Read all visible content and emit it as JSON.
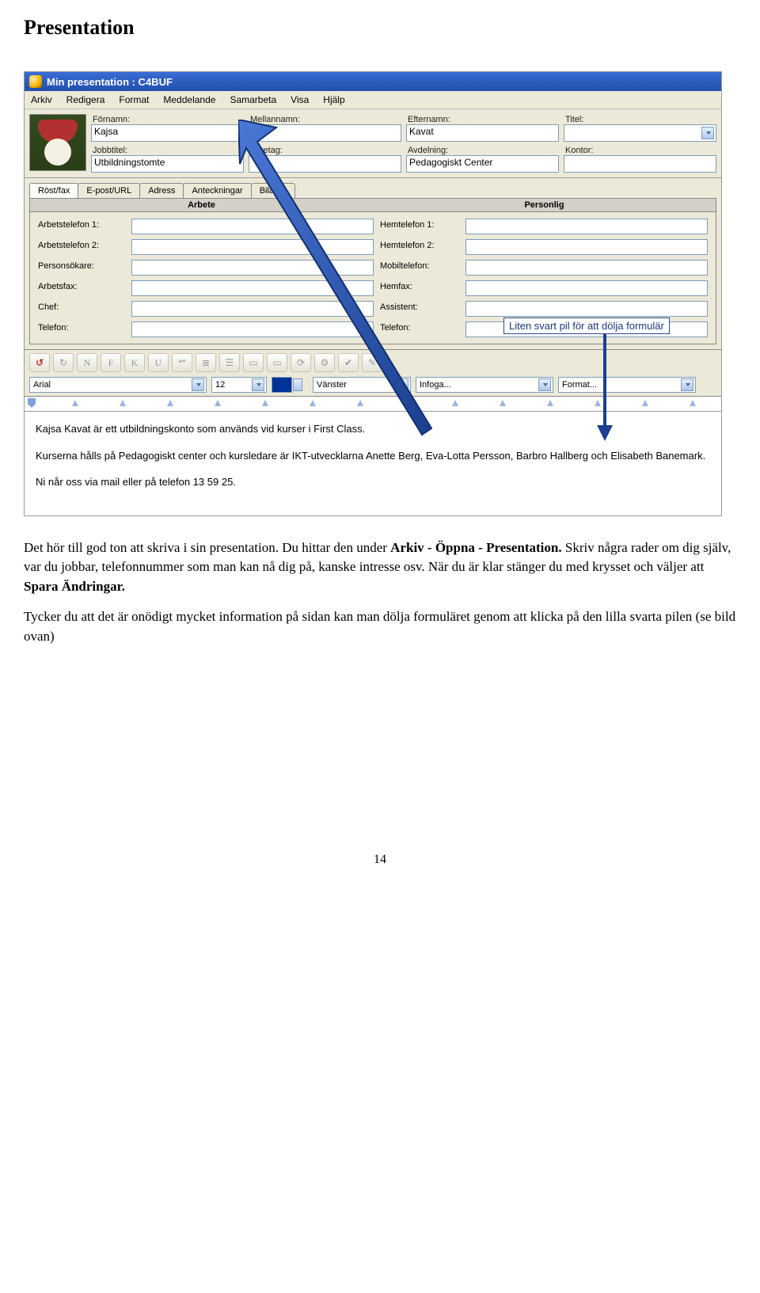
{
  "page": {
    "heading": "Presentation",
    "page_number": "14"
  },
  "window": {
    "title": "Min presentation  : C4BUF"
  },
  "menubar": [
    "Arkiv",
    "Redigera",
    "Format",
    "Meddelande",
    "Samarbeta",
    "Visa",
    "Hjälp"
  ],
  "form": {
    "row1": {
      "l1": "Förnamn:",
      "v1": "Kajsa",
      "l2": "Mellannamn:",
      "v2": "",
      "l3": "Efternamn:",
      "v3": "Kavat",
      "l4": "Titel:",
      "v4": ""
    },
    "row2": {
      "l1": "Jobbtitel:",
      "v1": "Utbildningstomte",
      "l2": "Företag:",
      "v2": "",
      "l3": "Avdelning:",
      "v3": "Pedagogiskt Center",
      "l4": "Kontor:",
      "v4": ""
    }
  },
  "tabs": [
    "Röst/fax",
    "E-post/URL",
    "Adress",
    "Anteckningar",
    "Bilagor"
  ],
  "colheads": {
    "left": "Arbete",
    "right": "Personlig"
  },
  "phones": {
    "l": [
      "Arbetstelefon 1:",
      "Arbetstelefon 2:",
      "Personsökare:",
      "Arbetsfax:",
      "Chef:",
      "Telefon:"
    ],
    "r": [
      "Hemtelefon 1:",
      "Hemtelefon 2:",
      "Mobiltelefon:",
      "Hemfax:",
      "Assistent:",
      "Telefon:"
    ]
  },
  "fmt": {
    "font": "Arial",
    "size": "12",
    "align": "Vänster",
    "insert": "Infoga...",
    "format": "Format..."
  },
  "editor": {
    "p1": "Kajsa Kavat är ett utbildningskonto som används vid kurser i First Class.",
    "p2": "Kurserna hålls på Pedagogiskt center och kursledare är IKT-utvecklarna Anette Berg, Eva-Lotta Persson, Barbro Hallberg och Elisabeth Banemark.",
    "p3": "Ni når oss via mail eller på telefon 13 59 25."
  },
  "callout": "Liten svart pil för att dölja formulär",
  "doc": {
    "p1_a": "Det hör till god ton att skriva i sin presentation. Du hittar den under ",
    "p1_b": "Arkiv - Öppna - Presentation.",
    "p1_c": " Skriv några rader om dig själv, var du jobbar, telefonnummer som man kan nå dig på, kanske intresse osv. När du är klar stänger du med krysset och väljer att ",
    "p1_d": "Spara Ändringar.",
    "p2": "Tycker du att det är onödigt mycket information på sidan kan man dölja formuläret genom att klicka på den lilla svarta pilen (se bild ovan)"
  }
}
